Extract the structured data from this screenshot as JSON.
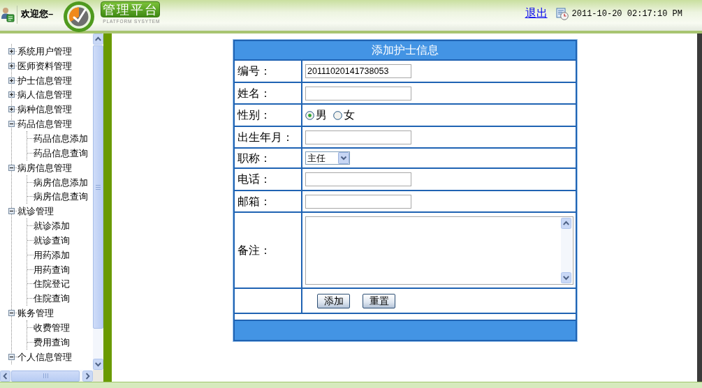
{
  "header": {
    "welcome": "欢迎您–",
    "logo_title": "管理平台",
    "logo_subtitle": "PLATFORM SYSYTEM",
    "logout": "退出",
    "datetime": "2011-10-20 02:17:10 PM"
  },
  "sidebar": {
    "tree": [
      {
        "label": "系统用户管理",
        "expanded": false
      },
      {
        "label": "医师资料管理",
        "expanded": false
      },
      {
        "label": "护士信息管理",
        "expanded": false
      },
      {
        "label": "病人信息管理",
        "expanded": false
      },
      {
        "label": "病种信息管理",
        "expanded": false
      },
      {
        "label": "药品信息管理",
        "expanded": true,
        "children": [
          {
            "label": "药品信息添加"
          },
          {
            "label": "药品信息查询"
          }
        ]
      },
      {
        "label": "病房信息管理",
        "expanded": true,
        "children": [
          {
            "label": "病房信息添加"
          },
          {
            "label": "病房信息查询"
          }
        ]
      },
      {
        "label": "就诊管理",
        "expanded": true,
        "children": [
          {
            "label": "就诊添加"
          },
          {
            "label": "就诊查询"
          },
          {
            "label": "用药添加"
          },
          {
            "label": "用药查询"
          },
          {
            "label": "住院登记"
          },
          {
            "label": "住院查询"
          }
        ]
      },
      {
        "label": "账务管理",
        "expanded": true,
        "children": [
          {
            "label": "收费管理"
          },
          {
            "label": "费用查询"
          }
        ]
      },
      {
        "label": "个人信息管理",
        "expanded": true
      }
    ]
  },
  "form": {
    "title": "添加护士信息",
    "rows": [
      {
        "kind": "text",
        "label": "编号：",
        "value": "20111020141738053"
      },
      {
        "kind": "text",
        "label": "姓名："
      },
      {
        "kind": "radio",
        "label": "性别：",
        "options": [
          {
            "label": "男",
            "selected": true
          },
          {
            "label": "女",
            "selected": false
          }
        ]
      },
      {
        "kind": "text",
        "label": "出生年月："
      },
      {
        "kind": "select",
        "label": "职称：",
        "value": "主任"
      },
      {
        "kind": "text",
        "label": "电话："
      },
      {
        "kind": "text",
        "label": "邮箱："
      },
      {
        "kind": "textarea",
        "label": "备注："
      }
    ],
    "buttons": [
      "添加",
      "重置"
    ]
  }
}
